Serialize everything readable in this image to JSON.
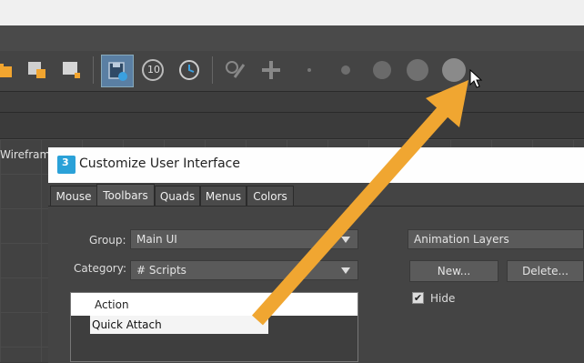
{
  "viewport": {
    "label": "Wireframe"
  },
  "toolbar": {
    "quick_align_badge": "10"
  },
  "dialog": {
    "title": "Customize User Interface",
    "logo_text": "3",
    "tabs": [
      {
        "label": "Mouse"
      },
      {
        "label": "Toolbars"
      },
      {
        "label": "Quads"
      },
      {
        "label": "Menus"
      },
      {
        "label": "Colors"
      }
    ],
    "group_label": "Group:",
    "group_value": "Main UI",
    "category_label": "Category:",
    "category_value": "# Scripts",
    "actions": [
      {
        "label": "Action"
      },
      {
        "label": "Quick Attach"
      }
    ],
    "toolbar_select_value": "Animation Layers",
    "new_button": "New...",
    "delete_button": "Delete...",
    "hide_label": "Hide",
    "hide_checked": true
  },
  "colors": {
    "annotation_arrow": "#f0a631",
    "dialog_bg": "#444444",
    "title_bg": "#fefefe"
  }
}
